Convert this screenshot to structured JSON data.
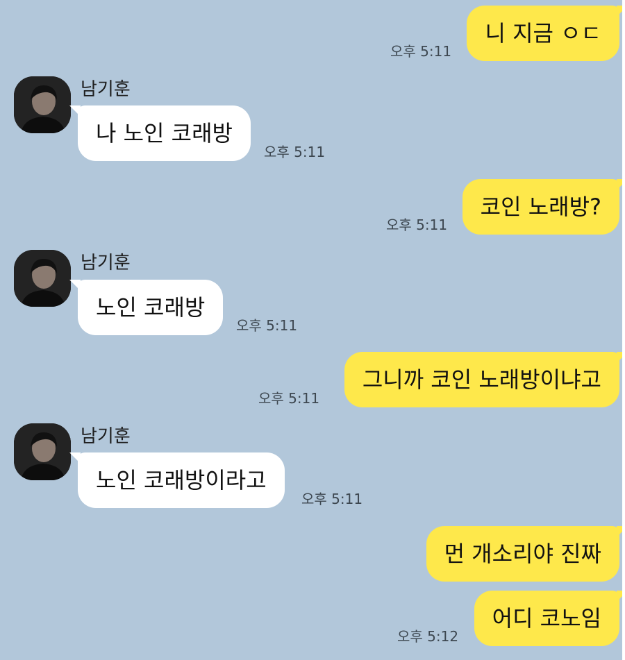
{
  "colors": {
    "background": "#b2c7da",
    "my_bubble": "#fee84b",
    "their_bubble": "#ffffff",
    "timestamp": "#3d4750"
  },
  "messages": [
    {
      "sender": "me",
      "text": "니 지금 ㅇㄷ",
      "time": "오후 5:11"
    },
    {
      "sender": "남기훈",
      "name": "남기훈",
      "avatar": "profile-photo",
      "text": "나 노인 코래방",
      "time": "오후 5:11"
    },
    {
      "sender": "me",
      "text": "코인 노래방?",
      "time": "오후 5:11"
    },
    {
      "sender": "남기훈",
      "name": "남기훈",
      "avatar": "profile-photo",
      "text": "노인 코래방",
      "time": "오후 5:11"
    },
    {
      "sender": "me",
      "text": "그니까 코인 노래방이냐고",
      "time": "오후 5:11"
    },
    {
      "sender": "남기훈",
      "name": "남기훈",
      "avatar": "profile-photo",
      "text": "노인 코래방이라고",
      "time": "오후 5:11"
    },
    {
      "sender": "me",
      "text": "먼 개소리야 진짜",
      "time": ""
    },
    {
      "sender": "me",
      "text": "어디 코노임",
      "time": "오후 5:12"
    }
  ]
}
